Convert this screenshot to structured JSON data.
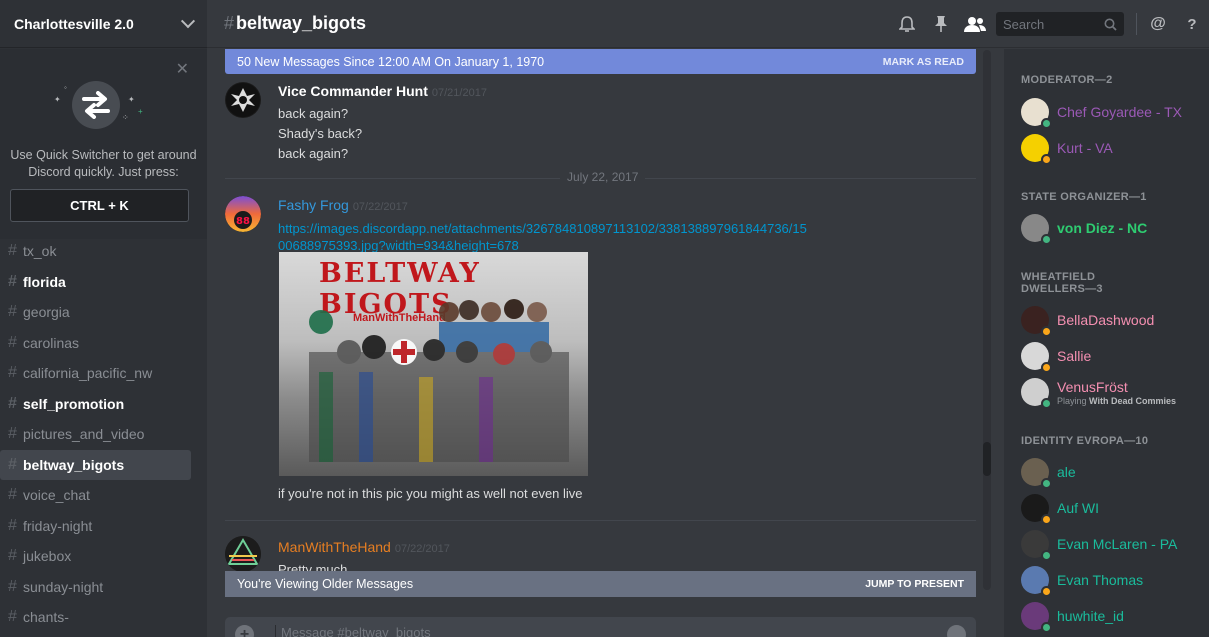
{
  "server": {
    "name": "Charlottesville 2.0"
  },
  "quick_switcher": {
    "text": "Use Quick Switcher to get around Discord quickly. Just press:",
    "shortcut": "CTRL + K"
  },
  "channels": [
    {
      "name": "tx_ok",
      "state": "normal"
    },
    {
      "name": "florida",
      "state": "unread"
    },
    {
      "name": "georgia",
      "state": "normal"
    },
    {
      "name": "carolinas",
      "state": "normal"
    },
    {
      "name": "california_pacific_nw",
      "state": "normal"
    },
    {
      "name": "self_promotion",
      "state": "unread"
    },
    {
      "name": "pictures_and_video",
      "state": "normal"
    },
    {
      "name": "beltway_bigots",
      "state": "active"
    },
    {
      "name": "voice_chat",
      "state": "normal"
    },
    {
      "name": "friday-night",
      "state": "normal"
    },
    {
      "name": "jukebox",
      "state": "normal"
    },
    {
      "name": "sunday-night",
      "state": "normal"
    },
    {
      "name": "chants-",
      "state": "normal"
    }
  ],
  "header": {
    "hash": "#",
    "channel": "beltway_bigots",
    "search_placeholder": "Search",
    "icons": [
      "bell-icon",
      "pin-icon",
      "members-icon",
      "search-icon",
      "at-icon",
      "help-icon"
    ]
  },
  "new_messages": {
    "text": "50 New Messages Since 12:00 AM On January 1, 1970",
    "action": "MARK AS READ"
  },
  "messages": [
    {
      "author": "Vice Commander Hunt",
      "color": "#ffffff",
      "time": "07/21/2017",
      "lines": [
        "back again?",
        "Shady's back?",
        "back again?"
      ]
    },
    {
      "author": "Fashy Frog",
      "color": "#3498db",
      "time": "07/22/2017",
      "link": "https://images.discordapp.net/attachments/326784810897113102/338138897961844736/1500688975393.jpg?width=934&height=678",
      "image_title": "BELTWAY BIGOTS",
      "image_caption": "ManWithTheHand",
      "lines": [
        "if you're not in this pic you might as well not even live"
      ]
    },
    {
      "author": "ManWithTheHand",
      "color": "#e67e22",
      "time": "07/22/2017",
      "lines": [
        "Pretty much"
      ]
    }
  ],
  "date_divider": "July 22, 2017",
  "older_bar": {
    "text": "You're Viewing Older Messages",
    "action": "JUMP TO PRESENT"
  },
  "composer": {
    "placeholder": "Message #beltway_bigots"
  },
  "member_groups": [
    {
      "title": "MODERATOR—2",
      "members": [
        {
          "name": "Chef Goyardee - TX",
          "color": "#9b59b6",
          "status": "online"
        },
        {
          "name": "Kurt - VA",
          "color": "#9b59b6",
          "status": "idle"
        }
      ]
    },
    {
      "title": "STATE ORGANIZER—1",
      "members": [
        {
          "name": "von Diez - NC",
          "color": "#2ecc71",
          "status": "online"
        }
      ]
    },
    {
      "title": "WHEATFIELD DWELLERS—3",
      "members": [
        {
          "name": "BellaDashwood",
          "color": "#f48fb1",
          "status": "idle"
        },
        {
          "name": "Sallie",
          "color": "#f48fb1",
          "status": "idle"
        },
        {
          "name": "VenusFröst",
          "color": "#f48fb1",
          "status": "online",
          "game_prefix": "Playing",
          "game": "With Dead Commies"
        }
      ]
    },
    {
      "title": "IDENTITY EVROPA—10",
      "members": [
        {
          "name": "ale",
          "color": "#1abc9c",
          "status": "online"
        },
        {
          "name": "Auf WI",
          "color": "#1abc9c",
          "status": "idle"
        },
        {
          "name": "Evan McLaren - PA",
          "color": "#1abc9c",
          "status": "online"
        },
        {
          "name": "Evan Thomas",
          "color": "#1abc9c",
          "status": "idle"
        },
        {
          "name": "huwhite_id",
          "color": "#1abc9c",
          "status": "online"
        }
      ]
    }
  ]
}
